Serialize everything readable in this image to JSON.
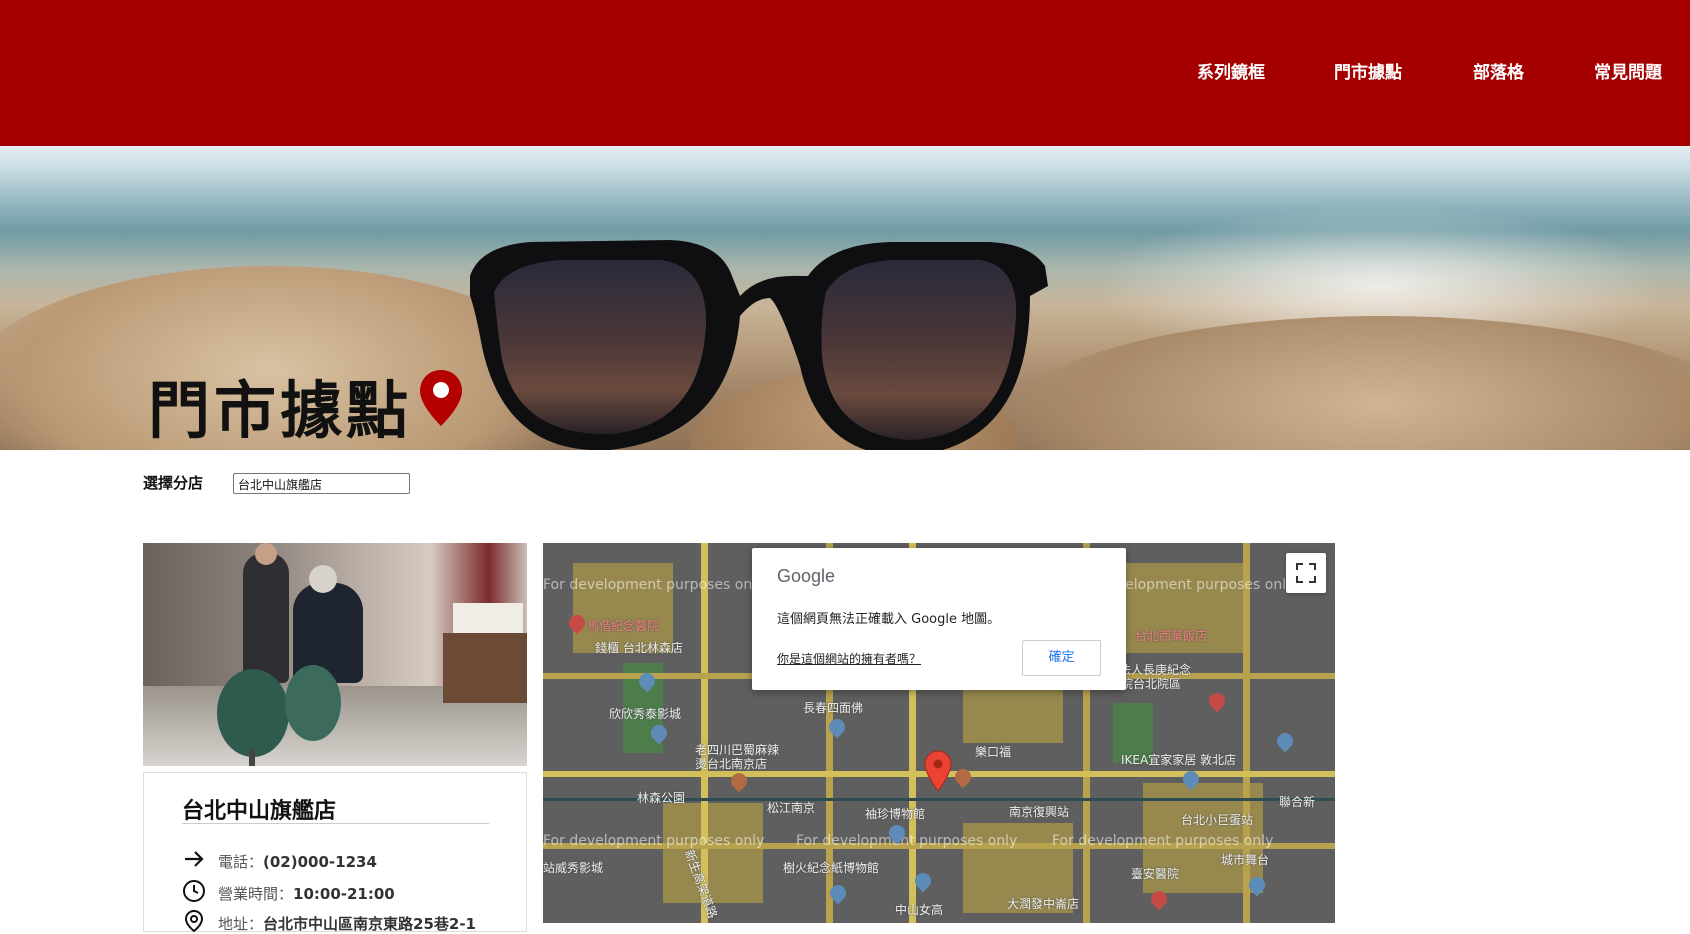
{
  "nav": {
    "items": [
      "系列鏡框",
      "門市據點",
      "部落格",
      "常見問題"
    ]
  },
  "hero": {
    "title": "門市據點",
    "icon": "map-pin-icon"
  },
  "store_select": {
    "label": "選擇分店",
    "value": "台北中山旗艦店"
  },
  "store": {
    "name": "台北中山旗艦店",
    "phone_label": "電話：",
    "phone": "(02)000-1234",
    "hours_label": "營業時間：",
    "hours": "10:00-21:00",
    "address_label": "地址：",
    "address": "台北市中山區南京東路25巷2-1"
  },
  "map": {
    "dev_watermark": "For development purposes only",
    "labels": {
      "l1": "馬偕紀念醫院",
      "l2": "錢櫃 台北林森店",
      "l3": "欣欣秀泰影城",
      "l4": "長春四面佛",
      "l5": "老四川巴蜀麻辣",
      "l6": "燙台北南京店",
      "l7": "林森公園",
      "l8": "松江南京",
      "l9": "袖珍博物館",
      "l10": "南京復興站",
      "l11": "樹火紀念紙博物館",
      "l12": "中山女高",
      "l13": "大潤發中崙店",
      "l14": "台北西華飯店",
      "l15": "財團法人長庚紀念",
      "l16": "醫院台北院區",
      "l17": "IKEA宜家家居 敦北店",
      "l18": "台北小巨蛋站",
      "l19": "聯合新",
      "l20": "城市舞台",
      "l21": "臺安醫院",
      "l22": "站威秀影城",
      "l23": "新生高架道路",
      "l24": "樂口福"
    },
    "dialog": {
      "logo": "Google",
      "message": "這個網頁無法正確載入 Google 地圖。",
      "owner_link": "你是這個網站的擁有者嗎？",
      "ok": "確定"
    }
  },
  "colors": {
    "header_bg": "#a50000",
    "map_bg": "#5f5f5f",
    "pin_red": "#ea4335",
    "accent_red": "#b50000"
  }
}
